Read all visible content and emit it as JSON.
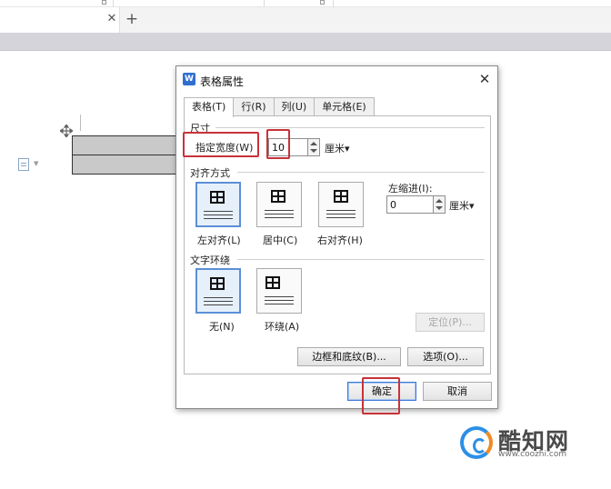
{
  "dialog": {
    "app_icon_letter": "W",
    "title": "表格属性",
    "close_glyph": "✕",
    "tabs": [
      {
        "label": "表格(T)"
      },
      {
        "label": "行(R)"
      },
      {
        "label": "列(U)"
      },
      {
        "label": "单元格(E)"
      }
    ],
    "size_group": {
      "label": "尺寸",
      "width_label": "指定宽度(W)",
      "width_value": "10",
      "unit": "厘米▾",
      "width_checked": true
    },
    "alignment_group": {
      "label": "对齐方式",
      "options": [
        {
          "label": "左对齐(L)",
          "selected": true
        },
        {
          "label": "居中(C)",
          "selected": false
        },
        {
          "label": "右对齐(H)",
          "selected": false
        }
      ],
      "indent_label": "左缩进(I):",
      "indent_value": "0",
      "indent_unit": "厘米▾"
    },
    "wrap_group": {
      "label": "文字环绕",
      "options": [
        {
          "label": "无(N)",
          "selected": true
        },
        {
          "label": "环绕(A)",
          "selected": false
        }
      ],
      "position_button": "定位(P)..."
    },
    "borders_button": "边框和底纹(B)...",
    "options_button": "选项(O)...",
    "ok_button": "确定",
    "cancel_button": "取消"
  },
  "editor": {
    "tab_close_glyph": "✕",
    "new_tab_glyph": "+",
    "table_move_glyph": "✥"
  },
  "watermark": {
    "name": "酷知网",
    "url": "www.coozhi.com"
  },
  "colors": {
    "highlight": "#c8323b",
    "selection": "#5c8fd6",
    "brand_blue": "#2d8fe6",
    "brand_orange": "#f08a24"
  }
}
